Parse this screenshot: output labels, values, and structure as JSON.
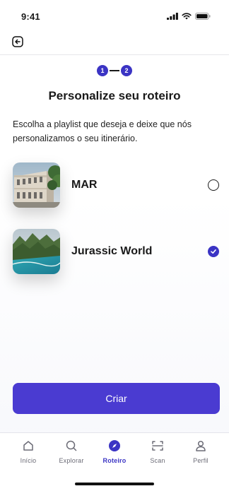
{
  "status_bar": {
    "time": "9:41"
  },
  "stepper": {
    "steps": [
      "1",
      "2"
    ]
  },
  "title": "Personalize seu roteiro",
  "description": "Escolha a playlist que deseja e deixe que nós personalizamos o seu itinerário.",
  "playlists": [
    {
      "name": "MAR",
      "selected": false
    },
    {
      "name": "Jurassic World",
      "selected": true
    }
  ],
  "create_button": {
    "label": "Criar"
  },
  "bottom_nav": {
    "items": [
      {
        "label": "Início",
        "icon": "home-icon",
        "active": false
      },
      {
        "label": "Explorar",
        "icon": "search-icon",
        "active": false
      },
      {
        "label": "Roteiro",
        "icon": "compass-icon",
        "active": true
      },
      {
        "label": "Scan",
        "icon": "scan-icon",
        "active": false
      },
      {
        "label": "Perfil",
        "icon": "user-icon",
        "active": false
      }
    ]
  },
  "colors": {
    "accent": "#3b34c4",
    "button": "#4a3bd1",
    "text": "#1a1a1a",
    "muted": "#6b6b76"
  }
}
